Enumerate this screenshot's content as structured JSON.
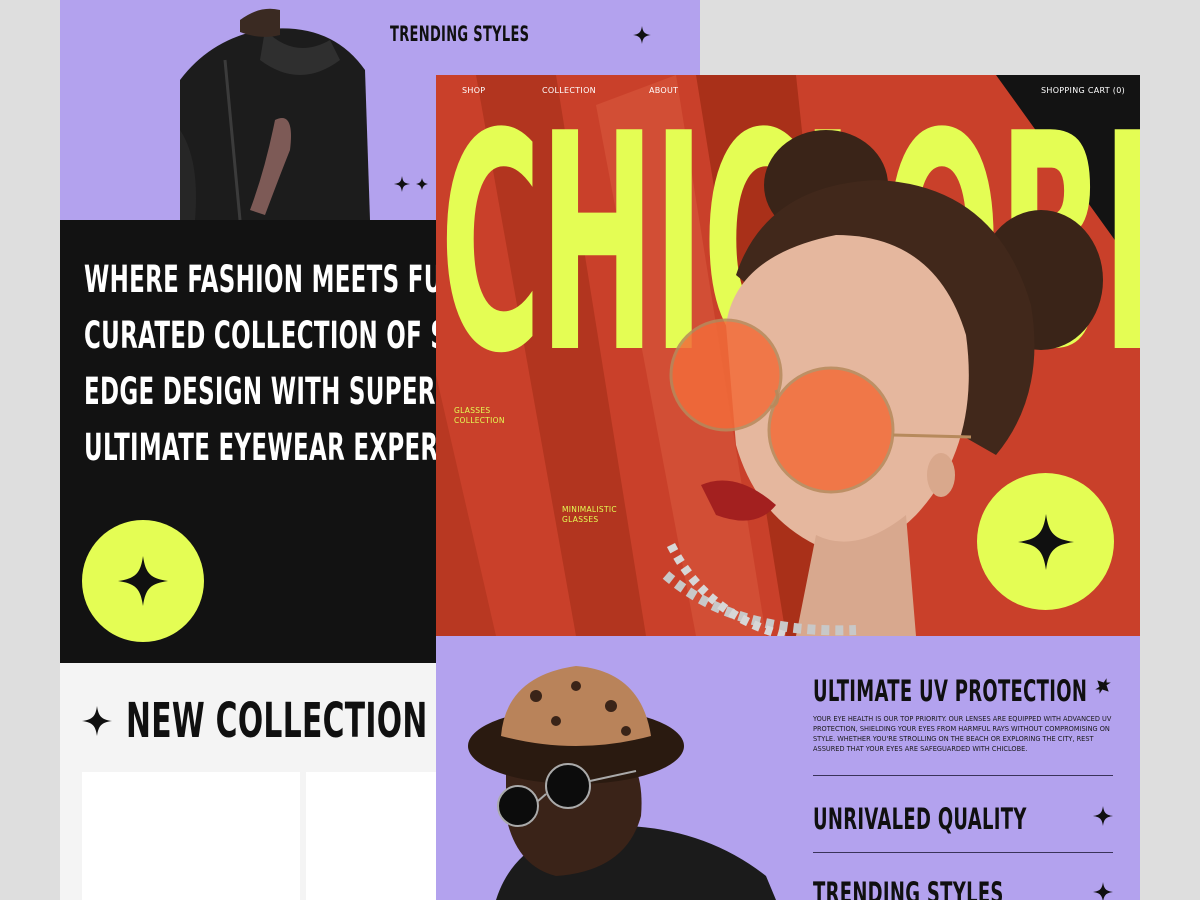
{
  "back": {
    "trending_label": "TRENDING STYLES",
    "tagline": [
      "WHERE FASHION MEETS FUNCTIONALITY",
      "CURATED COLLECTION OF SUNGLASSES",
      "EDGE DESIGN WITH SUPERIOR QUALITY",
      "ULTIMATE EYEWEAR EXPERIENCE"
    ],
    "new_collection": "NEW COLLECTION"
  },
  "nav": {
    "shop": "SHOP",
    "collection": "COLLECTION",
    "about": "ABOUT",
    "cart": "SHOPPING CART (0)"
  },
  "hero": {
    "brand": "CHICLOBE",
    "note_left": [
      "GLASSES",
      "COLLECTION"
    ],
    "note_mid": [
      "MINIMALISTIC",
      "GLASSES"
    ]
  },
  "features": [
    {
      "title": "ULTIMATE UV PROTECTION",
      "text": "YOUR EYE HEALTH IS OUR TOP PRIORITY. OUR LENSES ARE EQUIPPED WITH ADVANCED UV PROTECTION, SHIELDING YOUR EYES FROM HARMFUL RAYS WITHOUT COMPROMISING ON STYLE. WHETHER YOU'RE STROLLING ON THE BEACH OR EXPLORING THE CITY, REST ASSURED THAT YOUR EYES ARE SAFEGUARDED WITH CHICLOBE."
    },
    {
      "title": "UNRIVALED QUALITY"
    },
    {
      "title": "TRENDING STYLES"
    }
  ],
  "colors": {
    "lime": "#e4fd54",
    "lavender": "#b3a2ee",
    "hero_red": "#c9402a",
    "dark": "#121212"
  },
  "icons": [
    "sparkle-star-icon",
    "x-star-icon"
  ]
}
